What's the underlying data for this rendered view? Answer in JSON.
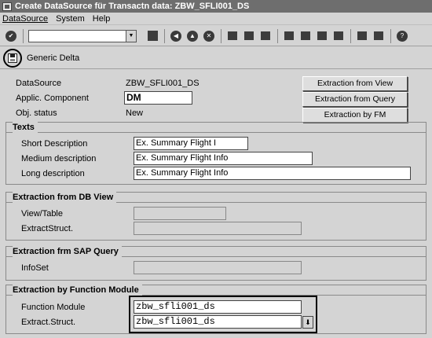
{
  "window": {
    "title": "Create DataSource für Transactn data: ZBW_SFLI001_DS"
  },
  "menu": {
    "items": [
      "DataSource",
      "System",
      "Help"
    ]
  },
  "toolbar": {
    "command_field_value": ""
  },
  "app_toolbar": {
    "generic_delta_label": "Generic Delta"
  },
  "header": {
    "datasource_label": "DataSource",
    "datasource_value": "ZBW_SFLI001_DS",
    "applic_component_label": "Applic. Component",
    "applic_component_value": "DM",
    "obj_status_label": "Obj. status",
    "obj_status_value": "New"
  },
  "side_buttons": {
    "extraction_from_view": "Extraction from View",
    "extraction_from_query": "Extraction from Query",
    "extraction_by_fm": "Extraction by FM"
  },
  "texts": {
    "title": "Texts",
    "short_label": "Short Description",
    "short_value": "Ex. Summary Flight I",
    "medium_label": "Medium description",
    "medium_value": "Ex. Summary Flight Info",
    "long_label": "Long description",
    "long_value": "Ex. Summary Flight Info"
  },
  "db_view": {
    "title": "Extraction from DB View",
    "view_table_label": "View/Table",
    "view_table_value": "",
    "extract_struct_label": "ExtractStruct.",
    "extract_struct_value": ""
  },
  "sap_query": {
    "title": "Extraction frm SAP Query",
    "infoset_label": "InfoSet",
    "infoset_value": ""
  },
  "function_module": {
    "title": "Extraction by Function Module",
    "fm_label": "Function Module",
    "fm_value": "zbw_sfli001_ds",
    "struct_label": "Extract.Struct.",
    "struct_value": "zbw_sfli001_ds"
  }
}
